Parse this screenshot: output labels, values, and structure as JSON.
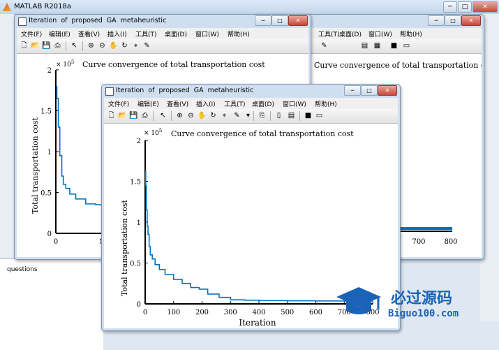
{
  "app": {
    "title": "MATLAB R2018a"
  },
  "side": {
    "questions": "questions",
    "q": "q"
  },
  "figures": [
    {
      "title": "Iteration  of  proposed  GA  metaheuristic",
      "menu": [
        "文件(F)",
        "编辑(E)",
        "查看(V)",
        "插入(I)",
        "工具(T)",
        "桌面(D)",
        "窗口(W)",
        "帮助(H)"
      ],
      "chart_data": {
        "type": "line",
        "title": "Curve convergence of   total transportation cost",
        "xlabel": "",
        "ylabel": "Total transportation cost",
        "xlim": [
          0,
          800
        ],
        "ylim": [
          0,
          200000
        ],
        "y_exponent": "× 10^5",
        "x_ticks": [
          "0",
          "100"
        ],
        "y_ticks": [
          "0",
          "0.5",
          "1",
          "1.5",
          "2"
        ],
        "series": [
          {
            "color": "#0072BD",
            "x": [
              0,
              2,
              5,
              8,
              12,
              15,
              20,
              28,
              40,
              60,
              80,
              100,
              140,
              180
            ],
            "y": [
              180000,
              165000,
              130000,
              95000,
              70000,
              60000,
              55000,
              48000,
              42000,
              36000,
              35000,
              34000,
              30000,
              18000
            ]
          }
        ]
      }
    },
    {
      "title": "Iteration  of  proposed  GA  metaheuristic",
      "menu": [
        "文件(F)",
        "编辑(E)",
        "查看(V)",
        "插入(I)",
        "工具(T)",
        "桌面(D)",
        "窗口(W)",
        "帮助(H)"
      ],
      "chart_data": {
        "type": "line",
        "title": "Curve convergence of   total transportation cost",
        "xlabel": "Iteration",
        "ylabel": "Total transportation cost",
        "xlim": [
          0,
          800
        ],
        "ylim": [
          0,
          200000
        ],
        "y_exponent": "× 10^5",
        "x_ticks": [
          "0",
          "100",
          "200",
          "300",
          "400",
          "500",
          "600",
          "700",
          "800"
        ],
        "y_ticks": [
          "0",
          "0.5",
          "1",
          "1.5",
          "2"
        ],
        "series": [
          {
            "color": "#0072BD",
            "x": [
              0,
              2,
              4,
              7,
              10,
              14,
              18,
              25,
              35,
              50,
              70,
              100,
              130,
              160,
              190,
              220,
              260,
              300,
              350,
              400,
              500,
              600,
              700,
              800
            ],
            "y": [
              162000,
              145000,
              115000,
              95000,
              85000,
              70000,
              60000,
              55000,
              48000,
              42000,
              36000,
              30000,
              25000,
              20000,
              18000,
              12000,
              8000,
              5000,
              4500,
              4000,
              3800,
              3600,
              3500,
              3500
            ]
          }
        ]
      }
    },
    {
      "title": "",
      "chart_data": {
        "type": "line",
        "title": "Curve convergence of   total transportation cost",
        "x_ticks": [
          "700",
          "800"
        ],
        "series": [
          {
            "color": "#0072BD"
          }
        ]
      }
    }
  ],
  "watermark": {
    "cn": "必过源码",
    "url": "Biguo100.com"
  }
}
